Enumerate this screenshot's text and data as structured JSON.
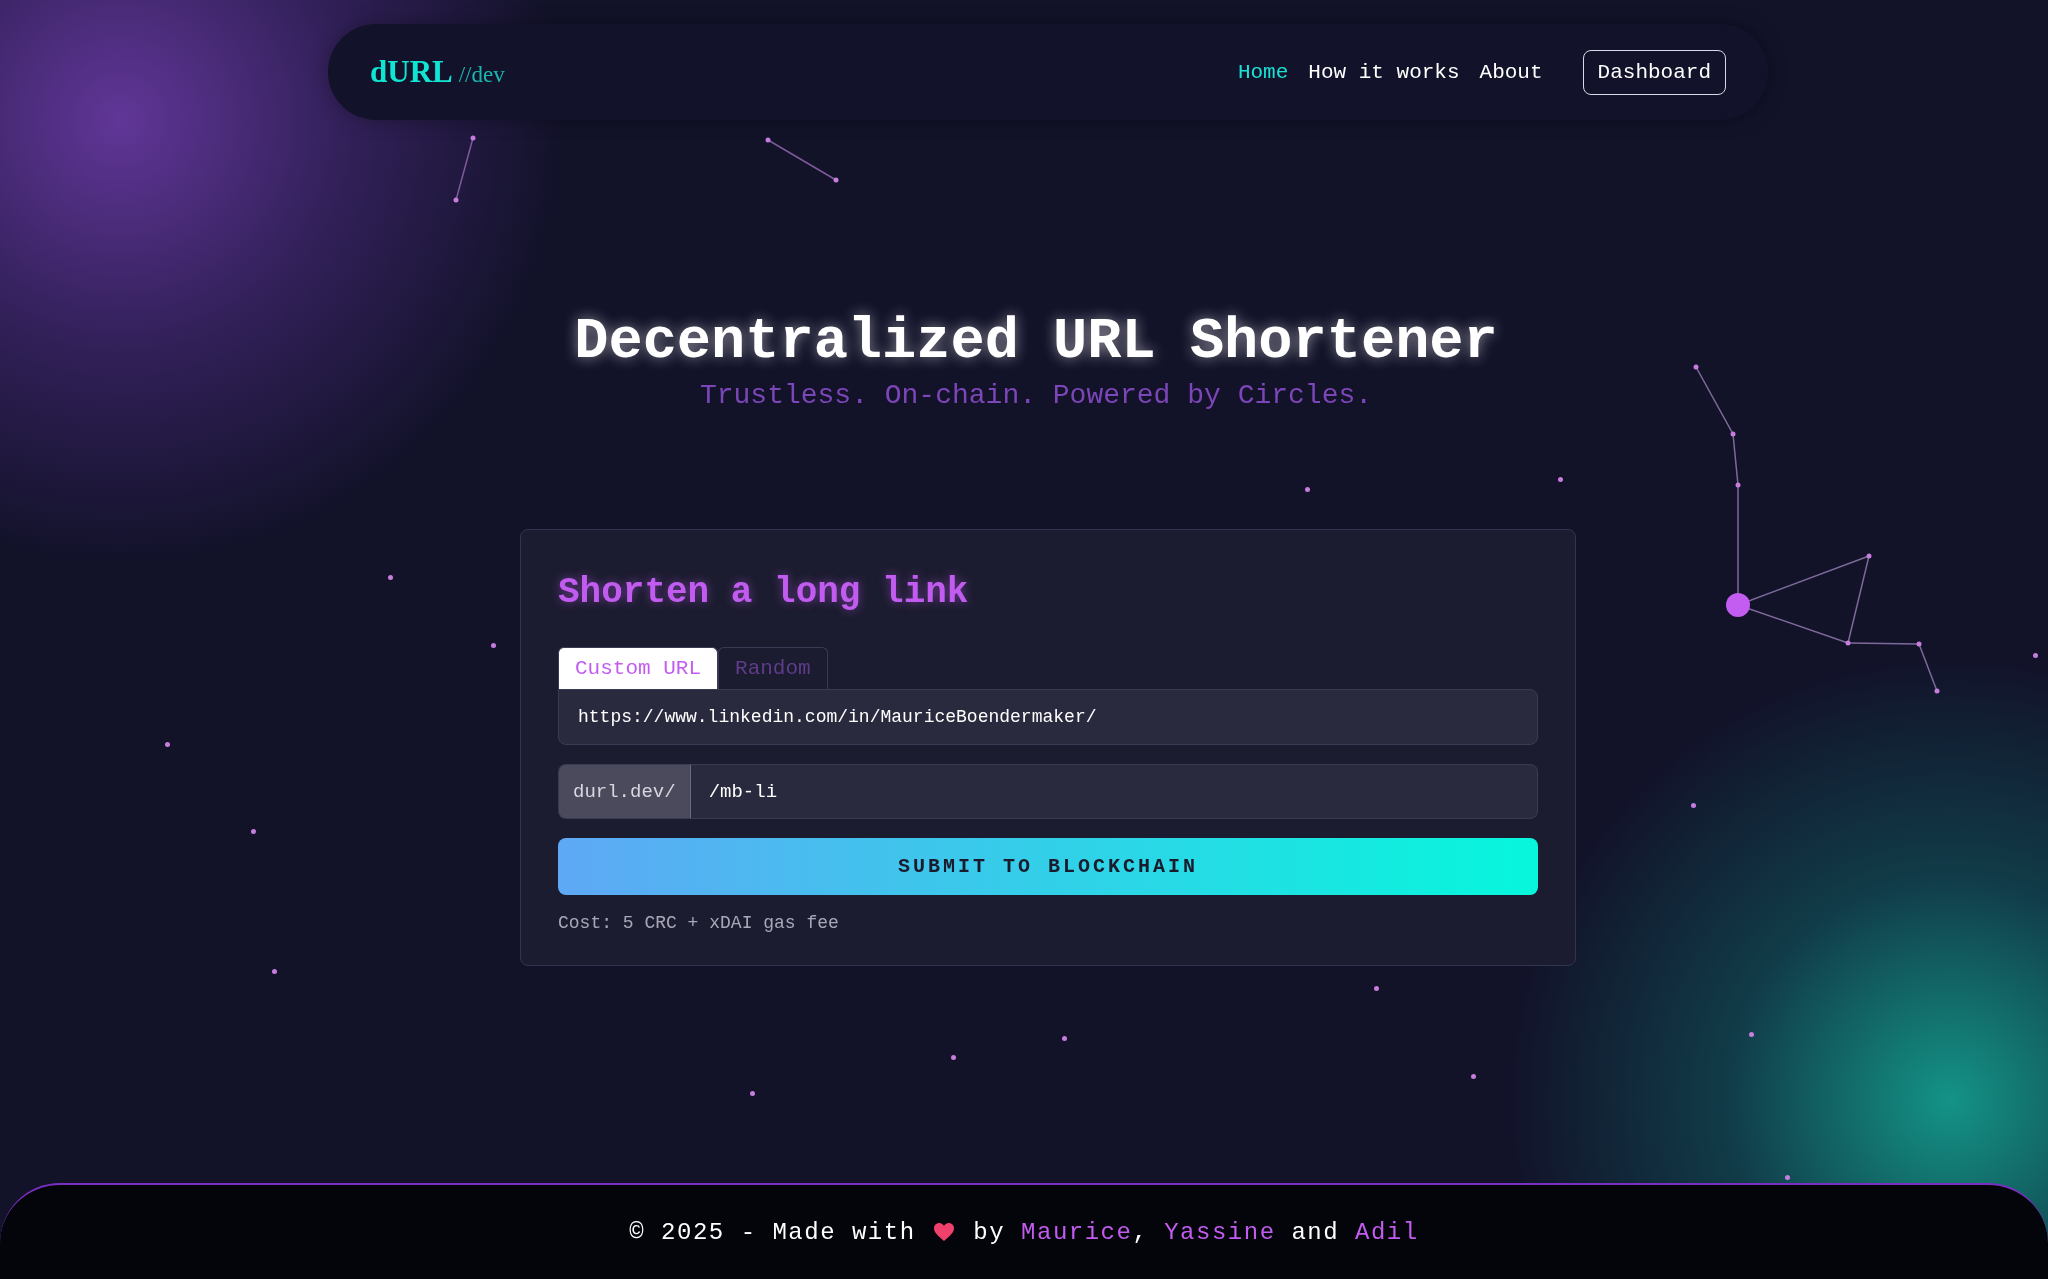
{
  "nav": {
    "logo": {
      "name": "dURL",
      "suffix": "//dev"
    },
    "links": [
      {
        "label": "Home",
        "selected": true
      },
      {
        "label": "How it works",
        "selected": false
      },
      {
        "label": "About",
        "selected": false
      }
    ],
    "button": "Dashboard"
  },
  "hero": {
    "title": "Decentralized URL Shortener",
    "subtitle": "Trustless. On-chain. Powered by Circles."
  },
  "card": {
    "heading": "Shorten a long link",
    "tabs": [
      {
        "label": "Custom URL",
        "selected": true
      },
      {
        "label": "Random",
        "selected": false
      }
    ],
    "url_field": {
      "value": "https://www.linkedin.com/in/MauriceBoendermaker/"
    },
    "slug_field": {
      "prefix": "durl.dev/",
      "value": "/mb-li"
    },
    "submit": "SUBMIT TO BLOCKCHAIN",
    "note": "Cost: 5 CRC + xDAI gas fee"
  },
  "footer": {
    "parts": [
      {
        "kind": "text",
        "text": "© 2025 - Made with "
      },
      {
        "kind": "heart"
      },
      {
        "kind": "text",
        "text": " by "
      },
      {
        "kind": "link",
        "text": "Maurice"
      },
      {
        "kind": "text",
        "text": ", "
      },
      {
        "kind": "link",
        "text": "Yassine"
      },
      {
        "kind": "text",
        "text": " and "
      },
      {
        "kind": "link",
        "text": "Adil"
      }
    ]
  }
}
